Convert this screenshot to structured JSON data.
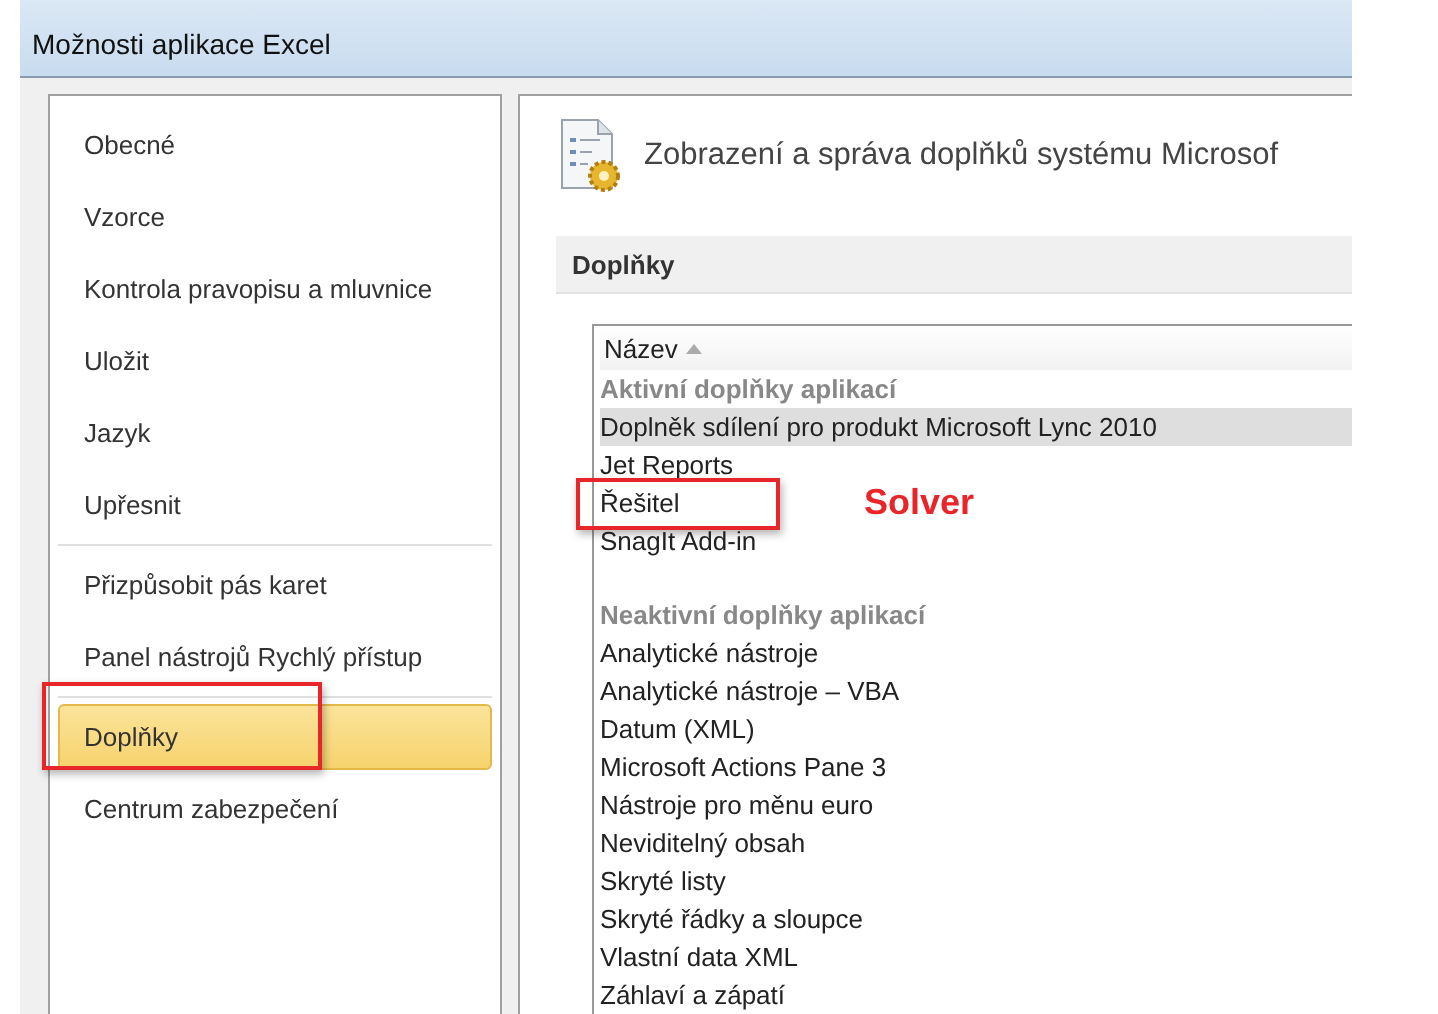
{
  "window": {
    "title": "Možnosti aplikace Excel"
  },
  "sidebar": {
    "groups": [
      {
        "items": [
          {
            "label": "Obecné",
            "selected": false,
            "highlighted": false
          },
          {
            "label": "Vzorce",
            "selected": false,
            "highlighted": false
          },
          {
            "label": "Kontrola pravopisu a mluvnice",
            "selected": false,
            "highlighted": false
          },
          {
            "label": "Uložit",
            "selected": false,
            "highlighted": false
          },
          {
            "label": "Jazyk",
            "selected": false,
            "highlighted": false
          },
          {
            "label": "Upřesnit",
            "selected": false,
            "highlighted": false
          }
        ]
      },
      {
        "items": [
          {
            "label": "Přizpůsobit pás karet",
            "selected": false,
            "highlighted": false
          },
          {
            "label": "Panel nástrojů Rychlý přístup",
            "selected": false,
            "highlighted": false
          }
        ]
      },
      {
        "items": [
          {
            "label": "Doplňky",
            "selected": true,
            "highlighted": true
          },
          {
            "label": "Centrum zabezpečení",
            "selected": false,
            "highlighted": false
          }
        ]
      }
    ]
  },
  "main": {
    "heading": "Zobrazení a správa doplňků systému Microsof",
    "section": "Doplňky",
    "table": {
      "column": "Název",
      "groups": [
        {
          "title": "Aktivní doplňky aplikací",
          "rows": [
            {
              "name": "Doplněk sdílení pro produkt Microsoft Lync 2010",
              "selected": true,
              "highlighted": false
            },
            {
              "name": "Jet Reports",
              "selected": false,
              "highlighted": false
            },
            {
              "name": "Řešitel",
              "selected": false,
              "highlighted": true,
              "annotation": "Solver"
            },
            {
              "name": "SnagIt Add-in",
              "selected": false,
              "highlighted": false
            }
          ]
        },
        {
          "title": "Neaktivní doplňky aplikací",
          "rows": [
            {
              "name": "Analytické nástroje",
              "selected": false,
              "highlighted": false
            },
            {
              "name": "Analytické nástroje – VBA",
              "selected": false,
              "highlighted": false
            },
            {
              "name": "Datum (XML)",
              "selected": false,
              "highlighted": false
            },
            {
              "name": "Microsoft Actions Pane 3",
              "selected": false,
              "highlighted": false
            },
            {
              "name": "Nástroje pro měnu euro",
              "selected": false,
              "highlighted": false
            },
            {
              "name": "Neviditelný obsah",
              "selected": false,
              "highlighted": false
            },
            {
              "name": "Skryté listy",
              "selected": false,
              "highlighted": false
            },
            {
              "name": "Skryté řádky a sloupce",
              "selected": false,
              "highlighted": false
            },
            {
              "name": "Vlastní data XML",
              "selected": false,
              "highlighted": false
            },
            {
              "name": "Záhlaví a zápatí",
              "selected": false,
              "highlighted": false
            }
          ]
        }
      ]
    }
  }
}
